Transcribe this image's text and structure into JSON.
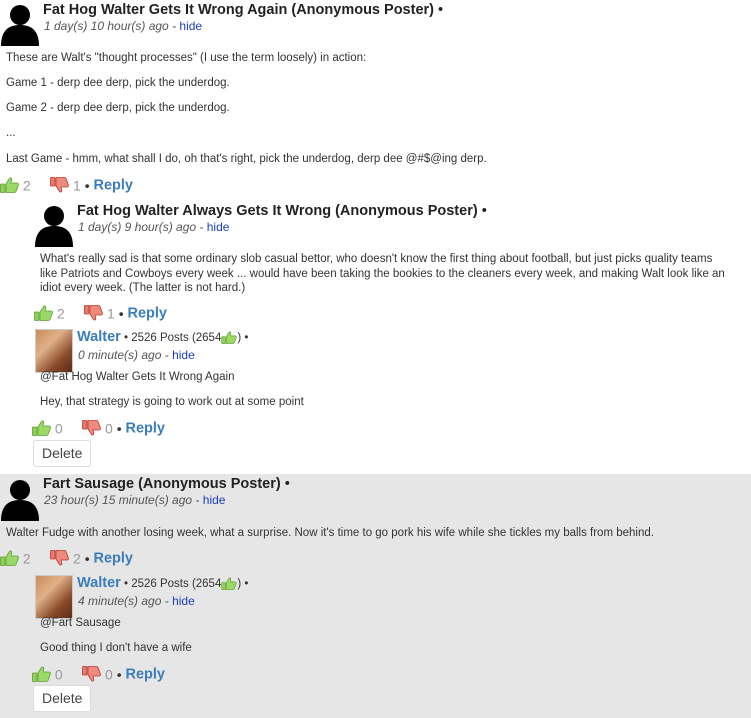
{
  "thread1": {
    "comment": {
      "name": "Fat Hog Walter Gets It Wrong Again (Anonymous Poster)",
      "bullet": "•",
      "time": "1 day(s) 10 hour(s) ago",
      "time_sep": "-",
      "hide": "hide",
      "lines": [
        "These are Walt's \"thought processes\" (I use the term loosely) in action:",
        "Game 1 - derp dee derp, pick the underdog.",
        "Game 2 - derp dee derp, pick the underdog.",
        "...",
        "Last Game  - hmm, what shall I do, oh that's right, pick the underdog, derp dee @#$@ing derp."
      ],
      "up": "2",
      "down": "1",
      "reply": "Reply",
      "bullet2": "•"
    },
    "reply1": {
      "name": "Fat Hog Walter Always Gets It Wrong (Anonymous Poster)",
      "bullet": "•",
      "time": "1 day(s) 9 hour(s) ago",
      "time_sep": "-",
      "hide": "hide",
      "text": "What's really sad is that some ordinary slob casual bettor, who doesn't know the first thing about football, but just picks quality teams like Patriots and Cowboys every week ... would have been taking the bookies to the cleaners every week, and making Walt look like an idiot every week. (The latter is not hard.)",
      "up": "2",
      "down": "1",
      "reply": "Reply",
      "bullet2": "•"
    },
    "reply2": {
      "name": "Walter",
      "posts": "• 2526 Posts (2654",
      "posts_end": ") •",
      "time": "0 minute(s) ago",
      "time_sep": "-",
      "hide": "hide",
      "mention": "@Fat Hog Walter Gets It Wrong Again",
      "text": "Hey, that strategy is going to work out at some point",
      "up": "0",
      "down": "0",
      "reply": "Reply",
      "bullet2": "•",
      "delete": "Delete"
    }
  },
  "thread2": {
    "comment": {
      "name": "Fart Sausage (Anonymous Poster)",
      "bullet": "•",
      "time": "23 hour(s) 15 minute(s) ago",
      "time_sep": "-",
      "hide": "hide",
      "text": "Walter Fudge with another losing week, what a surprise. Now it's time to go pork his wife while she tickles my balls from behind.",
      "up": "2",
      "down": "2",
      "reply": "Reply",
      "bullet2": "•"
    },
    "reply1": {
      "name": "Walter",
      "posts": "• 2526 Posts (2654",
      "posts_end": ") •",
      "time": "4 minute(s) ago",
      "time_sep": "-",
      "hide": "hide",
      "mention": "@Fart Sausage",
      "text": "Good thing I don't have a wife",
      "up": "0",
      "down": "0",
      "reply": "Reply",
      "bullet2": "•",
      "delete": "Delete"
    }
  },
  "colors": {
    "link": "#3a7dbb",
    "hide": "#1a3fc2",
    "thumb_up": "#7cc242",
    "thumb_down": "#e0574b",
    "thread2_bg": "#e6e6e6"
  },
  "icons": {
    "anon_avatar": "person-silhouette-icon",
    "thumb_up": "thumbs-up-icon",
    "thumb_down": "thumbs-down-icon"
  }
}
